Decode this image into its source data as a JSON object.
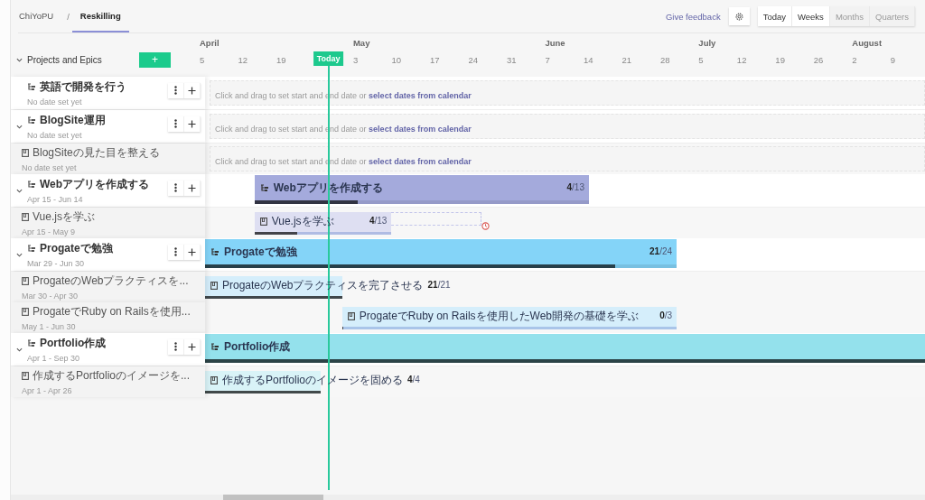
{
  "breadcrumbs": [
    {
      "label": "ChiYoPU",
      "selected": false
    },
    {
      "label": "Reskilling",
      "selected": true
    }
  ],
  "separator": "/",
  "toolbar": {
    "feedback_link": "Give feedback",
    "today_button": "Today",
    "scales": [
      {
        "label": "Weeks",
        "selected": true
      },
      {
        "label": "Months",
        "selected": false
      },
      {
        "label": "Quarters",
        "selected": false
      }
    ]
  },
  "sidebar_header": {
    "title": "Projects and Epics",
    "expanded": true,
    "add_button": "+"
  },
  "timeline": {
    "weeks": [
      {
        "label": "5",
        "month": "April",
        "today": false
      },
      {
        "label": "12",
        "today": false
      },
      {
        "label": "19",
        "today": false
      },
      {
        "today": true
      },
      {
        "label": "3",
        "month": "May",
        "today": false
      },
      {
        "label": "10",
        "today": false
      },
      {
        "label": "17",
        "today": false
      },
      {
        "label": "24",
        "today": false
      },
      {
        "label": "31",
        "today": false
      },
      {
        "label": "7",
        "month": "June",
        "today": false
      },
      {
        "label": "14",
        "today": false
      },
      {
        "label": "21",
        "today": false
      },
      {
        "label": "28",
        "today": false
      },
      {
        "label": "5",
        "month": "July",
        "today": false
      },
      {
        "label": "12",
        "today": false
      },
      {
        "label": "19",
        "today": false
      },
      {
        "label": "26",
        "today": false
      },
      {
        "label": "2",
        "month": "August",
        "today": false
      },
      {
        "label": "9",
        "today": false
      }
    ],
    "today_label": "Today"
  },
  "epics": [
    {
      "title": "英語で開発を行う",
      "dates": "No date set yet",
      "prompt": "Click and drag to set start and end date or",
      "prompt_link": "select dates from calendar"
    },
    {
      "title": "BlogSite運用",
      "dates": "No date set yet",
      "prompt": "Click and drag to set start and end date or",
      "prompt_link": "select dates from calendar",
      "expanded": true,
      "children": [
        {
          "title": "BlogSiteの見た目を整える",
          "dates": "No date set yet",
          "prompt": "Click and drag to set start and end date or",
          "prompt_link": "select dates from calendar"
        }
      ]
    },
    {
      "title": "Webアプリを作成する",
      "dates": "Apr 15 - Jun 14",
      "expanded": true,
      "bar": {
        "title": "Webアプリを作成する",
        "done": "4",
        "total": "/13",
        "level": 0.31,
        "color": "#a4aadc"
      },
      "children": [
        {
          "title": "Vue.jsを学ぶ",
          "dates": "Apr 15 - May 9",
          "bar": {
            "title": "Vue.jsを学ぶ",
            "done": "4",
            "total": "/13",
            "level": 0.31,
            "color": "#dedff2",
            "overdue": true
          }
        }
      ]
    },
    {
      "title": "Progateで勉強",
      "dates": "Mar 29 - Jun 30",
      "expanded": true,
      "bar": {
        "title": "Progateで勉強",
        "done": "21",
        "total": "/24",
        "level": 0.88,
        "color": "#84d4f8"
      },
      "children": [
        {
          "title": "ProgateのWebプラクティスを...",
          "dates": "Mar 30 - Apr 30",
          "bar": {
            "title": "ProgateのWebプラクティスを完了させる",
            "done": "21",
            "total": "/21",
            "level": 1,
            "color": "#d5eefb"
          }
        },
        {
          "title": "ProgateでRuby on Railsを使用...",
          "dates": "May 1 - Jun 30",
          "bar": {
            "title": "ProgateでRuby on Railsを使用したWeb開発の基礎を学ぶ",
            "done": "0",
            "total": "/3",
            "level": 0,
            "color": "#d5eefb"
          }
        }
      ]
    },
    {
      "title": "Portfolio作成",
      "dates": "Apr 1 - Sep 30",
      "expanded": true,
      "bar": {
        "title": "Portfolio作成",
        "level": 1,
        "color": "#94e1ec"
      },
      "children": [
        {
          "title": "作成するPortfolioのイメージを...",
          "dates": "Apr 1 - Apr 26",
          "bar": {
            "title": "作成するPortfolioのイメージを固める",
            "done": "4",
            "total": "/4",
            "level": 1,
            "color": "#d9f3f7"
          }
        }
      ]
    }
  ]
}
